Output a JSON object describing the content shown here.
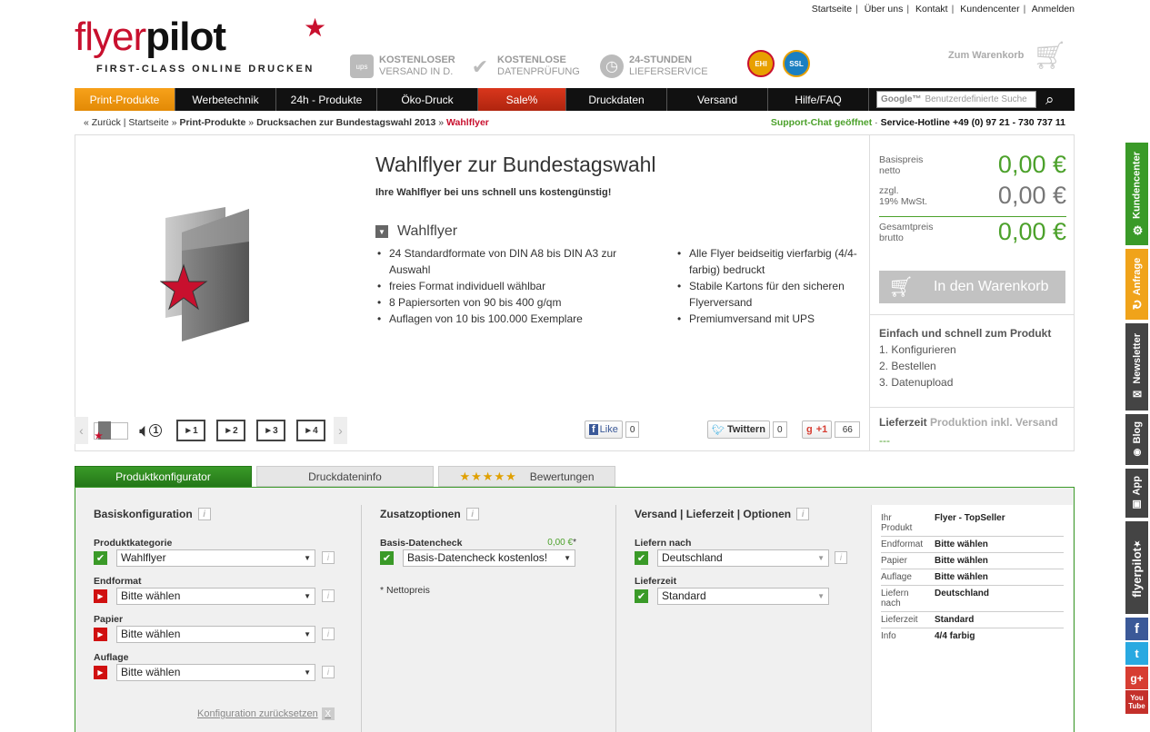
{
  "toplinks": [
    "Startseite",
    "Über uns",
    "Kontakt",
    "Kundencenter",
    "Anmelden"
  ],
  "logo": {
    "word1": "flyer",
    "word2": "pilot",
    "tagline": "FIRST-CLASS ONLINE DRUCKEN"
  },
  "features": [
    {
      "icon": "ups-icon",
      "glyph": "ups",
      "line1": "KOSTENLOSER",
      "line2": "VERSAND IN D."
    },
    {
      "icon": "checkmark-icon",
      "glyph": "✔",
      "line1": "KOSTENLOSE",
      "line2": "DATENPRÜFUNG"
    },
    {
      "icon": "clock-icon",
      "glyph": "◷",
      "line1": "24-STUNDEN",
      "line2": "LIEFERSERVICE"
    }
  ],
  "seals": [
    {
      "label": "EHI",
      "color": "#e8a000"
    },
    {
      "label": "SSL",
      "color": "#1a7fc1"
    }
  ],
  "cart_top": "Zum Warenkorb",
  "nav": {
    "items": [
      "Print-Produkte",
      "Werbetechnik",
      "24h - Produkte",
      "Öko-Druck",
      "Sale%",
      "Druckdaten",
      "Versand",
      "Hilfe/FAQ"
    ],
    "search_brand": "Google™",
    "search_placeholder": "Benutzerdefinierte Suche"
  },
  "breadcrumb": {
    "back": "« Zurück",
    "home": "Startseite",
    "l1": "Print-Produkte",
    "l2": "Drucksachen zur Bundestagswahl 2013",
    "current": "Wahlflyer"
  },
  "support": {
    "chat": "Support-Chat geöffnet",
    "hotline": "Service-Hotline +49 (0) 97 21 - 730 737 11"
  },
  "product": {
    "title": "Wahlflyer zur Bundestagswahl",
    "subtitle": "Ihre Wahlflyer bei uns schnell uns kostengünstig!",
    "section": "Wahlflyer",
    "features_left": [
      "24 Standardformate von DIN A8 bis DIN A3 zur Auswahl",
      "freies Format individuell wählbar",
      "8 Papiersorten von 90 bis 400 g/qm",
      "Auflagen von 10 bis 100.000 Exemplare"
    ],
    "features_right": [
      "Alle Flyer beidseitig vierfarbig (4/4-farbig) bedruckt",
      "Stabile Kartons für den sicheren Flyerversand",
      "Premiumversand mit UPS"
    ]
  },
  "thumbs": [
    "1",
    "1",
    "2",
    "3",
    "4"
  ],
  "social": {
    "like": "Like",
    "like_count": "0",
    "tweet": "Twittern",
    "tweet_count": "0",
    "plus": "+1",
    "plus_count": "66"
  },
  "prices": [
    {
      "label1": "Basispreis",
      "label2": "netto",
      "value": "0,00 €",
      "color": "#4ca12b"
    },
    {
      "label1": "zzgl.",
      "label2": "19% MwSt.",
      "value": "0,00 €",
      "color": "#777777"
    },
    {
      "label1": "Gesamtpreis",
      "label2": "brutto",
      "value": "0,00 €",
      "color": "#4ca12b"
    }
  ],
  "cart_button": "In den Warenkorb",
  "steps_heading": "Einfach und schnell zum Produkt",
  "steps": [
    "1.  Konfigurieren",
    "2.  Bestellen",
    "3.  Datenupload"
  ],
  "lieferzeit": {
    "label": "Lieferzeit",
    "note": "Produktion inkl. Versand",
    "value": "---"
  },
  "tabs": [
    "Produktkonfigurator",
    "Druckdateninfo",
    "Bewertungen"
  ],
  "tab_stars": "★★★★★",
  "config": {
    "basis": {
      "heading": "Basiskonfiguration",
      "fields": [
        {
          "label": "Produktkategorie",
          "value": "Wahlflyer",
          "state": "ok"
        },
        {
          "label": "Endformat",
          "value": "Bitte wählen",
          "state": "todo"
        },
        {
          "label": "Papier",
          "value": "Bitte wählen",
          "state": "todo"
        },
        {
          "label": "Auflage",
          "value": "Bitte wählen",
          "state": "todo"
        }
      ],
      "reset": "Konfiguration zurücksetzen"
    },
    "zusatz": {
      "heading": "Zusatzoptionen",
      "field_label": "Basis-Datencheck",
      "field_price": "0,00 €",
      "field_value": "Basis-Datencheck kostenlos!",
      "note": "* Nettopreis"
    },
    "versand": {
      "heading": "Versand | Lieferzeit | Optionen",
      "fields": [
        {
          "label": "Liefern nach",
          "value": "Deutschland"
        },
        {
          "label": "Lieferzeit",
          "value": "Standard"
        }
      ]
    }
  },
  "summary": [
    {
      "k": "Ihr Produkt",
      "v": "Flyer - TopSeller"
    },
    {
      "k": "Endformat",
      "v": "Bitte wählen"
    },
    {
      "k": "Papier",
      "v": "Bitte wählen"
    },
    {
      "k": "Auflage",
      "v": "Bitte wählen"
    },
    {
      "k": "Liefern nach",
      "v": "Deutschland"
    },
    {
      "k": "Lieferzeit",
      "v": "Standard"
    },
    {
      "k": "Info",
      "v": "4/4 farbig"
    }
  ],
  "sidebar": [
    {
      "label": "Kundencenter",
      "icon": "gear-icon",
      "glyph": "⚙",
      "color": "#3a9a28"
    },
    {
      "label": "Anfrage",
      "icon": "refresh-icon",
      "glyph": "↻",
      "color": "#f0a31a"
    },
    {
      "label": "Newsletter",
      "icon": "mail-icon",
      "glyph": "✉",
      "color": "#444444"
    },
    {
      "label": "Blog",
      "icon": "rss-icon",
      "glyph": "◉",
      "color": "#444444"
    },
    {
      "label": "App",
      "icon": "app-icon",
      "glyph": "▣",
      "color": "#444444"
    },
    {
      "label": "flyerpilot",
      "icon": "star-icon",
      "glyph": "★",
      "color": "#444444"
    }
  ],
  "sidebar_social": [
    {
      "label": "f",
      "icon": "facebook-icon",
      "color": "#3b5998"
    },
    {
      "label": "t",
      "icon": "twitter-icon",
      "color": "#29a9e1"
    },
    {
      "label": "g+",
      "icon": "google-plus-icon",
      "color": "#d73d32"
    },
    {
      "label": "You Tube",
      "icon": "youtube-icon",
      "color": "#c4302b"
    }
  ]
}
